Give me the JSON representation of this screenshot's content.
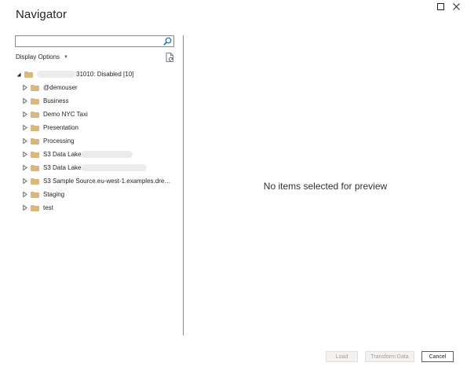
{
  "window": {
    "title": "Navigator",
    "controls": [
      "maximize-icon",
      "close-icon"
    ]
  },
  "search": {
    "value": "",
    "placeholder": "",
    "icon": "search-icon"
  },
  "toolbar": {
    "display_options_label": "Display Options",
    "refresh_icon": "refresh-icon"
  },
  "tree": {
    "root": {
      "label_suffix": "31010: Disabled [10]",
      "expanded": true
    },
    "items": [
      {
        "label": "@demouser"
      },
      {
        "label": "Business"
      },
      {
        "label": "Demo NYC Taxi"
      },
      {
        "label": "Presentation"
      },
      {
        "label": "Processing"
      },
      {
        "label": "S3 Data Lake"
      },
      {
        "label": "S3 Data Lake"
      },
      {
        "label": "S3 Sample Source.eu-west-1.examples.dremi..."
      },
      {
        "label": "Staging"
      },
      {
        "label": "test"
      }
    ]
  },
  "preview": {
    "empty_message": "No items selected for preview"
  },
  "footer": {
    "load_label": "Load",
    "transform_label": "Transform Data",
    "cancel_label": "Cancel"
  },
  "colors": {
    "folder": "#dcb67a",
    "border": "#8a8886",
    "disabled_bg": "#f3f2f1",
    "disabled_text": "#a19f9d"
  }
}
